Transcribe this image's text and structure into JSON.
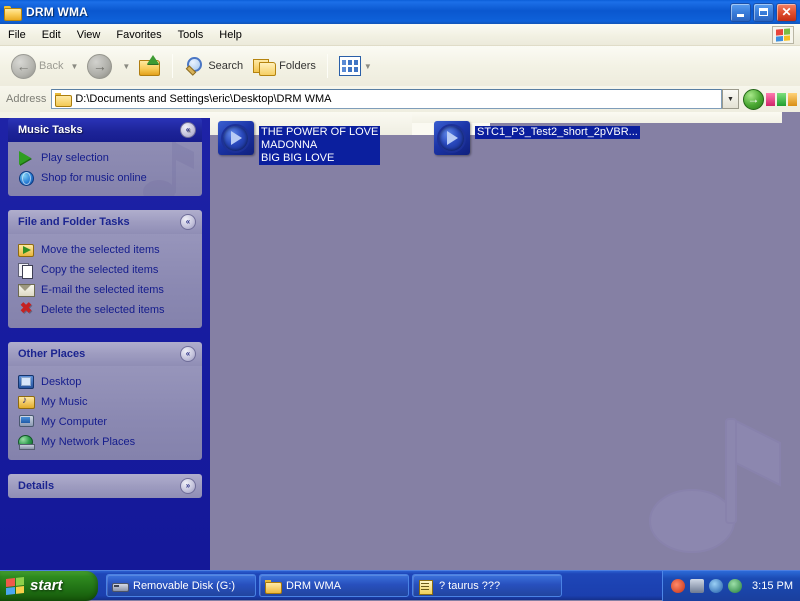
{
  "window": {
    "title": "DRM WMA",
    "folder_icon": "folder-icon",
    "minimize": "minimize-button",
    "maximize": "restore-button",
    "close": "close-button"
  },
  "menu": {
    "items": [
      "File",
      "Edit",
      "View",
      "Favorites",
      "Tools",
      "Help"
    ],
    "right_logo": "windows-flag-icon"
  },
  "toolbar": {
    "back_label": "Back",
    "forward_label": "",
    "up_label": "",
    "search_label": "Search",
    "folders_label": "Folders",
    "views_label": ""
  },
  "address": {
    "label": "Address",
    "value": "D:\\Documents and Settings\\eric\\Desktop\\DRM WMA",
    "go_label": "→"
  },
  "sidebar": {
    "panels": [
      {
        "title": "Music Tasks",
        "chevron": "«",
        "style": "music",
        "items": [
          {
            "label": "Play selection",
            "icon": "play-icon"
          },
          {
            "label": "Shop for music online",
            "icon": "globe-icon"
          }
        ]
      },
      {
        "title": "File and Folder Tasks",
        "chevron": "«",
        "style": "plain",
        "items": [
          {
            "label": "Move the selected items",
            "icon": "move-icon"
          },
          {
            "label": "Copy the selected items",
            "icon": "copy-icon"
          },
          {
            "label": "E-mail the selected items",
            "icon": "mail-icon"
          },
          {
            "label": "Delete the selected items",
            "icon": "delete-icon"
          }
        ]
      },
      {
        "title": "Other Places",
        "chevron": "«",
        "style": "plain",
        "items": [
          {
            "label": "Desktop",
            "icon": "desktop-icon"
          },
          {
            "label": "My Music",
            "icon": "my-music-icon"
          },
          {
            "label": "My Computer",
            "icon": "my-computer-icon"
          },
          {
            "label": "My Network Places",
            "icon": "my-network-places-icon"
          }
        ]
      },
      {
        "title": "Details",
        "chevron": "»",
        "style": "plain",
        "items": []
      }
    ]
  },
  "files": [
    {
      "name": "THE POWER OF LOVE\nMADONNA\nBIG BIG LOVE",
      "icon": "wma-media-icon",
      "selected": true
    },
    {
      "name": "STC1_P3_Test2_short_2pVBR...",
      "icon": "wma-media-icon",
      "selected": true
    }
  ],
  "taskbar": {
    "start_label": "start",
    "buttons": [
      {
        "label": "Removable Disk (G:)",
        "icon": "drive-icon"
      },
      {
        "label": "DRM WMA",
        "icon": "folder-icon"
      },
      {
        "label": "? taurus ???",
        "icon": "notepad-icon"
      }
    ],
    "tray_icons": [
      "volume-icon",
      "network-error-icon",
      "shield-icon",
      "display-icon"
    ],
    "clock": "3:15 PM"
  },
  "colors": {
    "titlebar_blue": "#0a57cf",
    "sidebar_blue": "#1a1f9e",
    "content_bg": "#8580a4",
    "selection_blue": "#0b1f9e",
    "taskbar_blue": "#1b3fae",
    "start_green": "#2f8b1f"
  }
}
